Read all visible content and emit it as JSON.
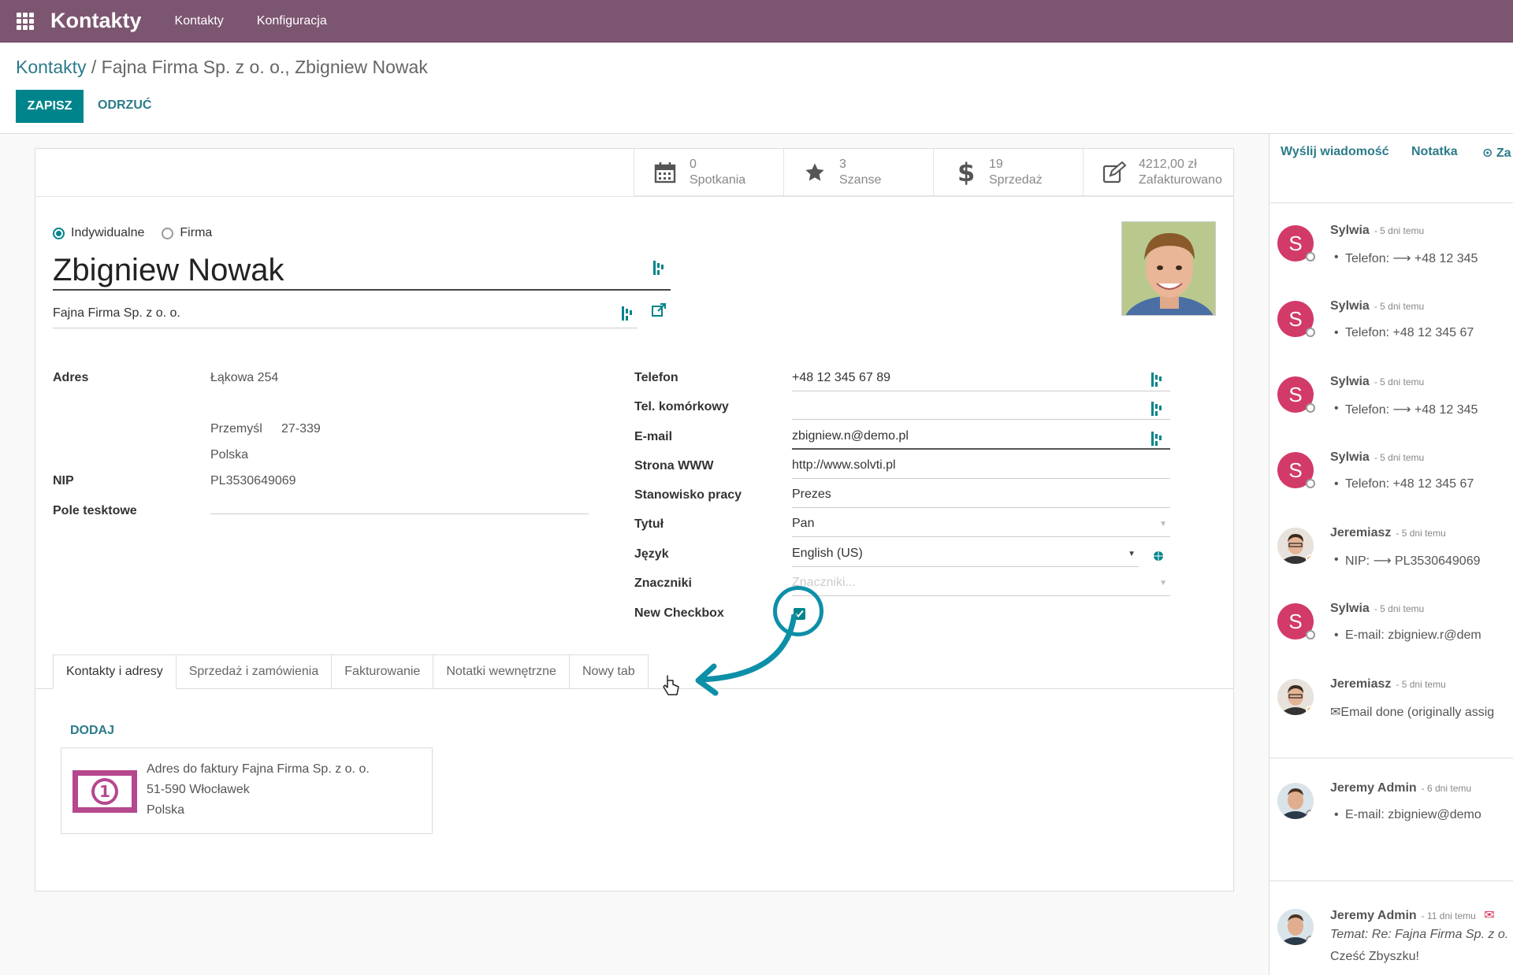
{
  "navbar": {
    "brand": "Kontakty",
    "menu": [
      "Kontakty",
      "Konfiguracja"
    ]
  },
  "breadcrumb": {
    "root": "Kontakty",
    "current": " / Fajna Firma Sp. z o. o., Zbigniew Nowak"
  },
  "actions": {
    "save": "ZAPISZ",
    "discard": "ODRZUĆ"
  },
  "stats": [
    {
      "icon": "calendar-icon",
      "count": "0",
      "label": "Spotkania"
    },
    {
      "icon": "star-icon",
      "count": "3",
      "label": "Szanse"
    },
    {
      "icon": "dollar-icon",
      "count": "19",
      "label": "Sprzedaż"
    },
    {
      "icon": "edit-icon",
      "count": "4212,00 zł",
      "label": "Zafakturowano"
    }
  ],
  "type": {
    "individual": "Indywidualne",
    "company": "Firma"
  },
  "contact": {
    "name": "Zbigniew Nowak",
    "company": "Fajna Firma Sp. z o. o."
  },
  "address": {
    "label": "Adres",
    "street": "Łąkowa 254",
    "city": "Przemyśl",
    "zip": "27-339",
    "country": "Polska",
    "nip_label": "NIP",
    "nip": "PL3530649069",
    "textfield_label": "Pole tesktowe"
  },
  "right_fields": {
    "phone_label": "Telefon",
    "phone": "+48 12 345 67 89",
    "mobile_label": "Tel. komórkowy",
    "mobile": "",
    "email_label": "E-mail",
    "email": "zbigniew.n@demo.pl",
    "www_label": "Strona WWW",
    "www": "http://www.solvti.pl",
    "job_label": "Stanowisko pracy",
    "job": "Prezes",
    "title_label": "Tytuł",
    "title": "Pan",
    "lang_label": "Język",
    "lang": "English (US)",
    "tags_label": "Znaczniki",
    "tags_placeholder": "Znaczniki...",
    "checkbox_label": "New Checkbox"
  },
  "tabs": [
    "Kontakty i adresy",
    "Sprzedaż i zamówienia",
    "Fakturowanie",
    "Notatki wewnętrzne",
    "Nowy tab"
  ],
  "contacts_tab": {
    "add": "DODAJ",
    "card": [
      "Adres do faktury Fajna Firma Sp. z o. o.",
      "51-590 Włocławek",
      "Polska"
    ]
  },
  "chatter": {
    "send": "Wyślij wiadomość",
    "note": "Notatka",
    "schedule": "Za",
    "messages": [
      {
        "author": "Sylwia",
        "time": "- 5 dni temu",
        "body": "Telefon: ⟶ +48 12 345"
      },
      {
        "author": "Sylwia",
        "time": "- 5 dni temu",
        "body": "Telefon: +48 12 345 67"
      },
      {
        "author": "Sylwia",
        "time": "- 5 dni temu",
        "body": "Telefon: ⟶ +48 12 345"
      },
      {
        "author": "Sylwia",
        "time": "- 5 dni temu",
        "body": "Telefon: +48 12 345 67"
      },
      {
        "author": "Jeremiasz",
        "time": "- 5 dni temu",
        "body": "NIP: ⟶ PL3530649069"
      },
      {
        "author": "Sylwia",
        "time": "- 5 dni temu",
        "body": "E-mail: zbigniew.r@dem"
      },
      {
        "author": "Jeremiasz",
        "time": "- 5 dni temu",
        "body": "Email done (originally assig"
      },
      {
        "author": "Jeremy Admin",
        "time": "- 6 dni temu",
        "body": "E-mail: zbigniew@demo"
      },
      {
        "author": "Jeremy Admin",
        "time": "- 11 dni temu",
        "body": "Temat: Re: Fajna Firma Sp. z o.",
        "body2": "Cześć Zbyszku!"
      }
    ]
  },
  "colors": {
    "navbar": "#7c5570",
    "primary": "#00848c",
    "link": "#2c7b8a",
    "avatar": "#d23a68",
    "annotation": "#0d8fa8"
  }
}
